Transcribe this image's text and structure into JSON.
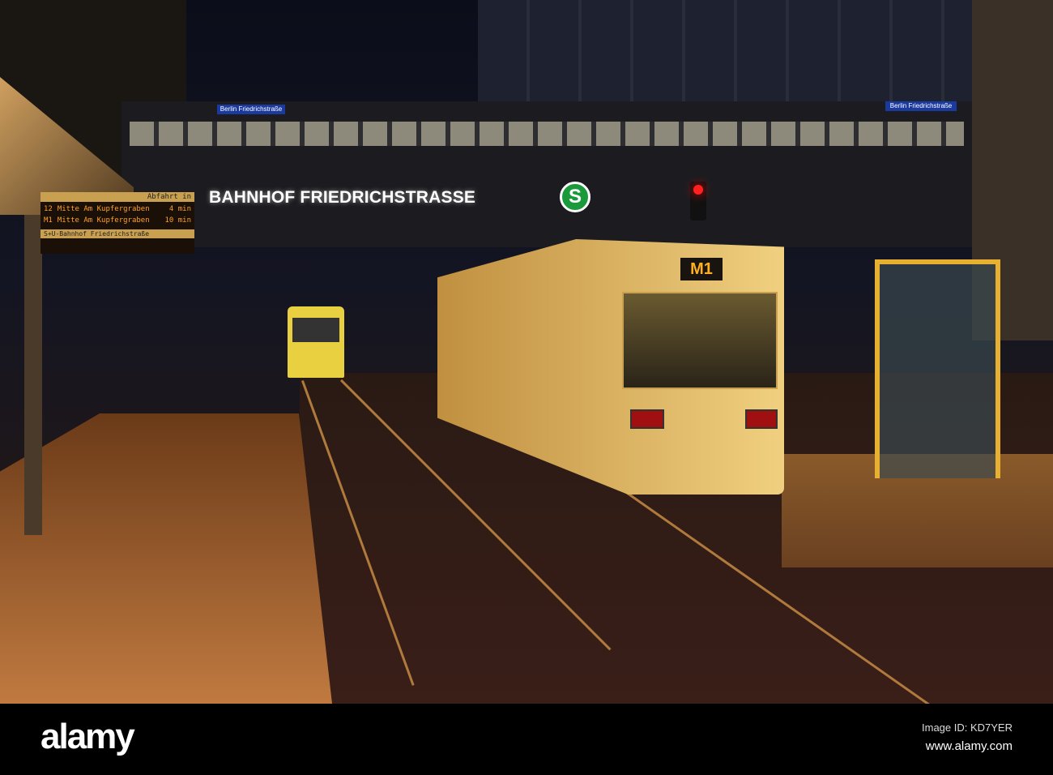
{
  "photo": {
    "station_sign": "BAHNHOF FRIEDRICHSTRASSE",
    "s_bahn_logo": "S",
    "platform_signs": [
      "Berlin Friedrichstraße",
      "Berlin Friedrichstraße"
    ],
    "tram_route": "M1",
    "departure_board": {
      "header": "Abfahrt in",
      "rows": [
        {
          "line": "12",
          "destination": "Mitte Am Kupfergraben",
          "time": "4 min"
        },
        {
          "line": "M1",
          "destination": "Mitte Am Kupfergraben",
          "time": "10 min"
        }
      ],
      "footer": "S+U-Bahnhof Friedrichstraße"
    },
    "colors": {
      "tram": "#e8c060",
      "sign_green": "#1a9a3a",
      "signal_red": "#ff2020"
    }
  },
  "watermark": {
    "logo": "alamy",
    "image_id": "Image ID: KD7YER",
    "url": "www.alamy.com"
  }
}
